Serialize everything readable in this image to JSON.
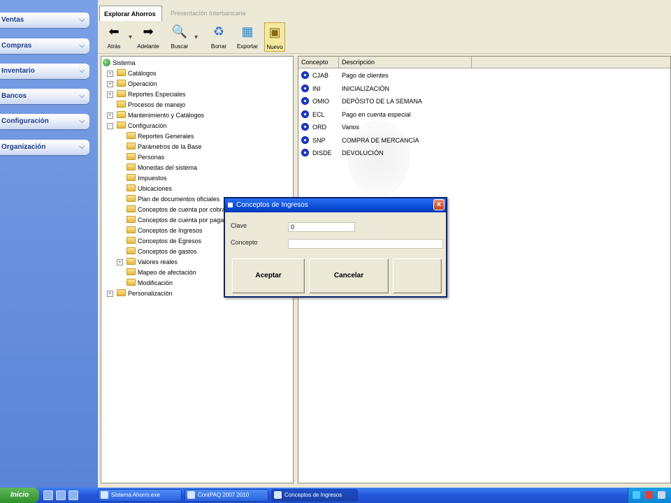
{
  "sidebar": {
    "buttons": [
      {
        "label": "Ventas",
        "icon": "chevron-down-icon"
      },
      {
        "label": "Compras",
        "icon": "chevron-down-icon"
      },
      {
        "label": "Inventario",
        "icon": "chevron-down-icon"
      },
      {
        "label": "Bancos",
        "icon": "chevron-down-icon"
      },
      {
        "label": "Configuración",
        "icon": "chevron-down-icon"
      },
      {
        "label": "Organización",
        "icon": "chevron-down-icon"
      }
    ]
  },
  "tabs": {
    "active": "Explorar Ahorros",
    "inactive": "Presentación Interbancaria"
  },
  "toolbar": {
    "back": "Atrás",
    "forward": "Adelante",
    "search": "Buscar",
    "delete": "Borrar",
    "export": "Exportar",
    "new": "Nuevo"
  },
  "tree": {
    "root": "Sistema",
    "nodes": [
      {
        "label": "Catálogos",
        "level": 1,
        "expander": "+"
      },
      {
        "label": "Operación",
        "level": 1,
        "expander": "+"
      },
      {
        "label": "Reportes Especiales",
        "level": 1,
        "expander": "+"
      },
      {
        "label": "Procesos de manejo",
        "level": 1,
        "expander": ""
      },
      {
        "label": "Mantenimiento y Catálogos",
        "level": 1,
        "expander": "+"
      },
      {
        "label": "Configuración",
        "level": 1,
        "expander": "-"
      },
      {
        "label": "Reportes Generales",
        "level": 2,
        "expander": ""
      },
      {
        "label": "Parámetros de la Base",
        "level": 2,
        "expander": ""
      },
      {
        "label": "Personas",
        "level": 2,
        "expander": ""
      },
      {
        "label": "Monedas del sistema",
        "level": 2,
        "expander": ""
      },
      {
        "label": "Impuestos",
        "level": 2,
        "expander": ""
      },
      {
        "label": "Ubicaciones",
        "level": 2,
        "expander": ""
      },
      {
        "label": "Plan de documentos oficiales",
        "level": 2,
        "expander": ""
      },
      {
        "label": "Conceptos de cuenta por cobrar",
        "level": 2,
        "expander": ""
      },
      {
        "label": "Conceptos de cuenta por pagar",
        "level": 2,
        "expander": ""
      },
      {
        "label": "Conceptos de Ingresos",
        "level": 2,
        "expander": ""
      },
      {
        "label": "Conceptos de Egresos",
        "level": 2,
        "expander": ""
      },
      {
        "label": "Conceptos de gastos",
        "level": 2,
        "expander": ""
      },
      {
        "label": "Valores reales",
        "level": 2,
        "expander": "+"
      },
      {
        "label": "Mapeo de afectación",
        "level": 2,
        "expander": ""
      },
      {
        "label": "Modificación",
        "level": 2,
        "expander": ""
      },
      {
        "label": "Personalización",
        "level": 1,
        "expander": "+"
      }
    ]
  },
  "list": {
    "headers": [
      "Concepto",
      "Descripción"
    ],
    "rows": [
      {
        "code": "CJAB",
        "desc": "Pago de clientes"
      },
      {
        "code": "INI",
        "desc": "INICIALIZACIÓN"
      },
      {
        "code": "OMIO",
        "desc": "DEPÓSITO DE LA SEMANA"
      },
      {
        "code": "ECL",
        "desc": "Pago en cuenta especial"
      },
      {
        "code": "ORD",
        "desc": "Varios"
      },
      {
        "code": "SNP",
        "desc": "COMPRA DE MERCANCÍA"
      },
      {
        "code": "DISDE",
        "desc": "DEVOLUCIÓN"
      }
    ]
  },
  "dialog": {
    "title": "Conceptos de Ingresos",
    "close": "×",
    "clave_label": "Clave",
    "clave_value": "0",
    "concepto_label": "Concepto",
    "concepto_value": "",
    "accept": "Aceptar",
    "cancel": "Cancelar"
  },
  "taskbar": {
    "start": "Inicio",
    "items": [
      {
        "label": "Sistema Ahorro.exe",
        "active": false
      },
      {
        "label": "ContPAQ 2007 2010",
        "active": false
      },
      {
        "label": "Conceptos de Ingresos",
        "active": true
      }
    ]
  }
}
